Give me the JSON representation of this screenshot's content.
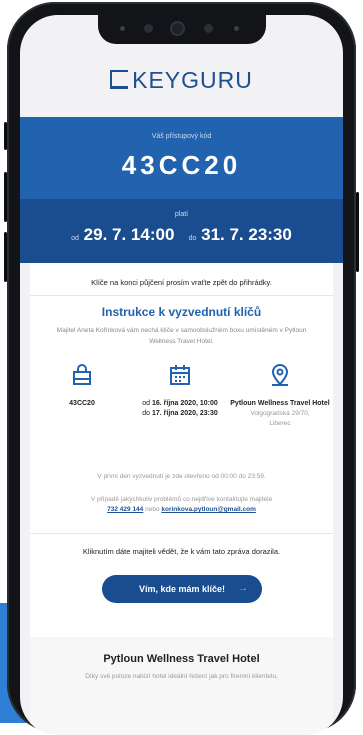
{
  "brand": {
    "name": "KEYGURU"
  },
  "access": {
    "label": "Váš přístupový kód",
    "code": "43CC20"
  },
  "validity": {
    "label": "platí",
    "from_prefix": "od",
    "from": "29. 7. 14:00",
    "to_prefix": "do",
    "to": "31. 7. 23:30"
  },
  "return_note": "Klíče na konci půjčení prosím vraťte zpět do přihrádky.",
  "instructions": {
    "title": "Instrukce k vyzvednutí klíčů",
    "description": "Majitel Aneta Kořínková vám nechá klíče v samoobslužném boxu umístěném v Pytloun Wellness Travel Hotel.",
    "code_col": {
      "value": "43CC20"
    },
    "date_col": {
      "from_prefix": "od",
      "from": "16. října 2020, 10:00",
      "to_prefix": "do",
      "to": "17. října 2020, 23:30"
    },
    "place_col": {
      "name": "Pytloun Wellness Travel Hotel",
      "street": "Volgogradská 29/70,",
      "city": "Liberec"
    },
    "first_day": "V první den vyzvednutí je zde otevřeno od 00:00 do 23:59.",
    "problems_line1": "V případě jakýchkoliv problémů co nejdříve kontaktujte majitele",
    "phone": "732 429 144",
    "or": "nebo",
    "email": "korinkova.pytloun@gmail.com"
  },
  "confirm": {
    "text": "Kliknutím dáte majiteli vědět, že k vám tato zpráva dorazila.",
    "button": "Vím, kde mám klíče!"
  },
  "hotel": {
    "name": "Pytloun Wellness Travel Hotel",
    "description": "Díky své poloze nabízí hotel ideální řešení jak pro firemní klientelu,"
  },
  "colors": {
    "primary": "#2163ae",
    "primary_dark": "#1a4d8f",
    "background": "#f2f2f4"
  }
}
